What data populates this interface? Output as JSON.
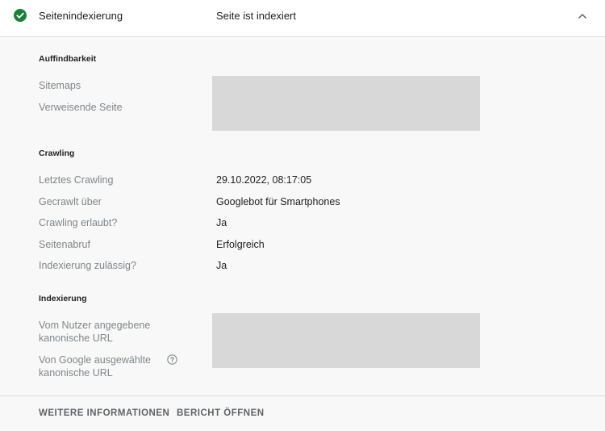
{
  "header": {
    "title": "Seitenindexierung",
    "status": "Seite ist indexiert",
    "status_icon": "check-circle-icon",
    "status_color": "#188038",
    "collapse_icon": "chevron-up-icon"
  },
  "discoverability": {
    "title": "Auffindbarkeit",
    "rows": [
      {
        "label": "Sitemaps"
      },
      {
        "label": "Verweisende Seite"
      }
    ]
  },
  "crawling": {
    "title": "Crawling",
    "rows": [
      {
        "label": "Letztes Crawling",
        "value": "29.10.2022, 08:17:05"
      },
      {
        "label": "Gecrawlt über",
        "value": "Googlebot für Smartphones"
      },
      {
        "label": "Crawling erlaubt?",
        "value": "Ja"
      },
      {
        "label": "Seitenabruf",
        "value": "Erfolgreich"
      },
      {
        "label": "Indexierung zulässig?",
        "value": "Ja"
      }
    ]
  },
  "indexing": {
    "title": "Indexierung",
    "rows": [
      {
        "label_line1": "Vom Nutzer angegebene",
        "label_line2": "kanonische URL"
      },
      {
        "label_line1": "Von Google ausgewählte",
        "label_line2": "kanonische URL",
        "help_icon": "help-circle-icon"
      }
    ]
  },
  "footer": {
    "more_info": "WEITERE INFORMATIONEN",
    "open_report": "BERICHT ÖFFNEN"
  }
}
